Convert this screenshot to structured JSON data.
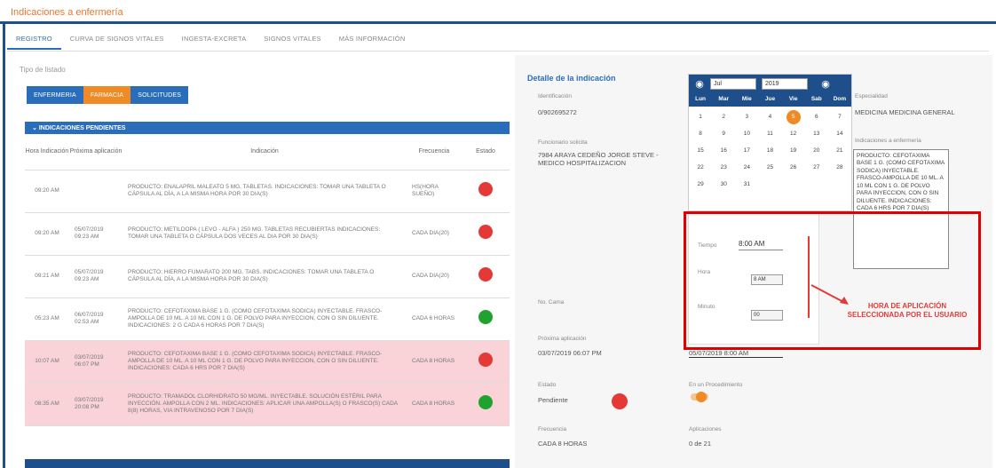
{
  "header": {
    "title": "Indicaciones a enfermería"
  },
  "tabs": [
    "REGISTRO",
    "CURVA DE SIGNOS VITALES",
    "INGESTA-EXCRETA",
    "SIGNOS VITALES",
    "MÁS INFORMACIÓN"
  ],
  "tipo_label": "Tipo de listado",
  "list_buttons": [
    "ENFERMERIA",
    "FARMACIA",
    "SOLICITUDES"
  ],
  "table": {
    "section_title": "INDICACIONES PENDIENTES",
    "columns": [
      "Hora Indicación",
      "Próxima aplicación",
      "Indicación",
      "Frecuencia",
      "Estado"
    ],
    "rows": [
      {
        "hora": "09:20 AM",
        "proxima": "",
        "indicacion": "PRODUCTO: ENALAPRIL MALEATO 5 MG. TABLETAS. INDICACIONES: TOMAR UNA TABLETA O CÁPSULA AL DÍA, A LA MISMA HORA POR 30 DIA(S)",
        "frecuencia": "HS(HORA SUEÑO)",
        "estado": "red",
        "highlight": false
      },
      {
        "hora": "09:20 AM",
        "proxima": "05/07/2019 09:23 AM",
        "indicacion": "PRODUCTO: METILDOPA ( LEVO - ALFA ) 250 MG. TABLETAS RECUBIERTAS INDICACIONES: TOMAR UNA TABLETA O CÁPSULA DOS VECES AL DIA POR 30 DIA(S)",
        "frecuencia": "CADA DIA(20)",
        "estado": "red",
        "highlight": false
      },
      {
        "hora": "09:21 AM",
        "proxima": "05/07/2019 09:23 AM",
        "indicacion": "PRODUCTO: HIERRO FUMARATO 200 MG. TABS. INDICACIONES: TOMAR UNA TABLETA O CÁPSULA AL DÍA, A LA MISMA HORA POR 30 DIA(S)",
        "frecuencia": "CADA DIA(20)",
        "estado": "red",
        "highlight": false
      },
      {
        "hora": "05:23 AM",
        "proxima": "06/07/2019 02:53 AM",
        "indicacion": "PRODUCTO: CEFOTAXIMA BASE 1 G. (COMO CEFOTAXIMA SODICA) INYECTABLE. FRASCO-AMPOLLA DE 10 ML. A 10 ML CON 1 G. DE POLVO PARA INYECCION, CON O SIN DILUENTE. INDICACIONES: 2 G CADA 6 HORAS POR 7 DIA(S)",
        "frecuencia": "CADA 6 HORAS",
        "estado": "green",
        "highlight": false
      },
      {
        "hora": "10:07 AM",
        "proxima": "03/07/2019 06:07 PM",
        "indicacion": "PRODUCTO: CEFOTAXIMA BASE 1 G. (COMO CEFOTAXIMA SODICA) INYECTABLE. FRASCO-AMPOLLA DE 10 ML. A 10 ML CON 1 G. DE POLVO PARA INYECCION, CON O SIN DILUENTE. INDICACIONES: CADA 6 HRS POR 7 DIA(S)",
        "frecuencia": "CADA 8 HORAS",
        "estado": "red",
        "highlight": true
      },
      {
        "hora": "08:35 AM",
        "proxima": "03/07/2019 20:08 PM",
        "indicacion": "PRODUCTO: TRAMADOL CLORHIDRATO 50 MG/ML. INYECTABLE. SOLUCIÓN ESTÉRIL PARA INYECCIÓN. AMPOLLA CON 2 ML. INDICACIONES: APLICAR UNA AMPOLLA(S) O FRASCO(S) CADA 8(8) HORAS, VIA INTRAVENOSO POR 7 DIA(S)",
        "frecuencia": "CADA 8 HORAS",
        "estado": "green",
        "highlight": true
      }
    ]
  },
  "detail": {
    "title": "Detalle de la indicación",
    "identificacion_label": "Identificación",
    "identificacion_value": "0/902695272",
    "funcionario_label": "Funcionario solicita",
    "funcionario_value": "7984 ARAYA CEDEÑO JORGE STEVE - MEDICO HOSPITALIZACION",
    "especialidad_label": "Especialidad",
    "especialidad_value": "MEDICINA MEDICINA GENERAL",
    "indicaciones_label": "Indicaciones a enfermería",
    "indicaciones_value": "PRODUCTO: CEFOTAXIMA BASE 1 G. (COMO CEFOTAXIMA SODICA) INYECTABLE. FRASCO-AMPOLLA DE 10 ML. A 10 ML CON 1 G. DE POLVO PARA INYECCION, CON O SIN DILUENTE. INDICACIONES: CADA 6 HRS POR 7 DIA(S)",
    "cama_label": "No. Cama",
    "proxima_label": "Próxima aplicación",
    "proxima_value": "03/07/2019 06:07 PM",
    "proxima_input": "05/07/2019 8:00 AM",
    "estado_label": "Estado",
    "estado_value": "Pendiente",
    "procedimiento_label": "En un Procedimiento",
    "frecuencia_label": "Frecuencia",
    "frecuencia_value": "CADA 8 HORAS",
    "aplicaciones_label": "Aplicaciones",
    "aplicaciones_value": "0 de 21"
  },
  "calendar": {
    "month": "Jul",
    "year": "2019",
    "weekdays": [
      "Lun",
      "Mar",
      "Mie",
      "Jue",
      "Vie",
      "Sab",
      "Dom"
    ],
    "days": [
      "1",
      "2",
      "3",
      "4",
      "5",
      "6",
      "7",
      "8",
      "9",
      "10",
      "11",
      "12",
      "13",
      "14",
      "15",
      "16",
      "17",
      "18",
      "19",
      "20",
      "21",
      "22",
      "23",
      "24",
      "25",
      "26",
      "27",
      "28",
      "29",
      "30",
      "31"
    ],
    "selected": "5"
  },
  "time_picker": {
    "tiempo_label": "Tiempo",
    "tiempo_value": "8:00 AM",
    "hora_label": "Hora",
    "hora_value": "8 AM",
    "minuto_label": "Minuto",
    "minuto_value": "00"
  },
  "annotation": "HORA DE APLICACIÓN SELECCIONADA POR EL USUARIO",
  "colors": {
    "accent": "#2a6ebb",
    "orange": "#f08a24",
    "pink": "#f9d3d8",
    "red": "#e53935",
    "green": "#1fa32f"
  }
}
